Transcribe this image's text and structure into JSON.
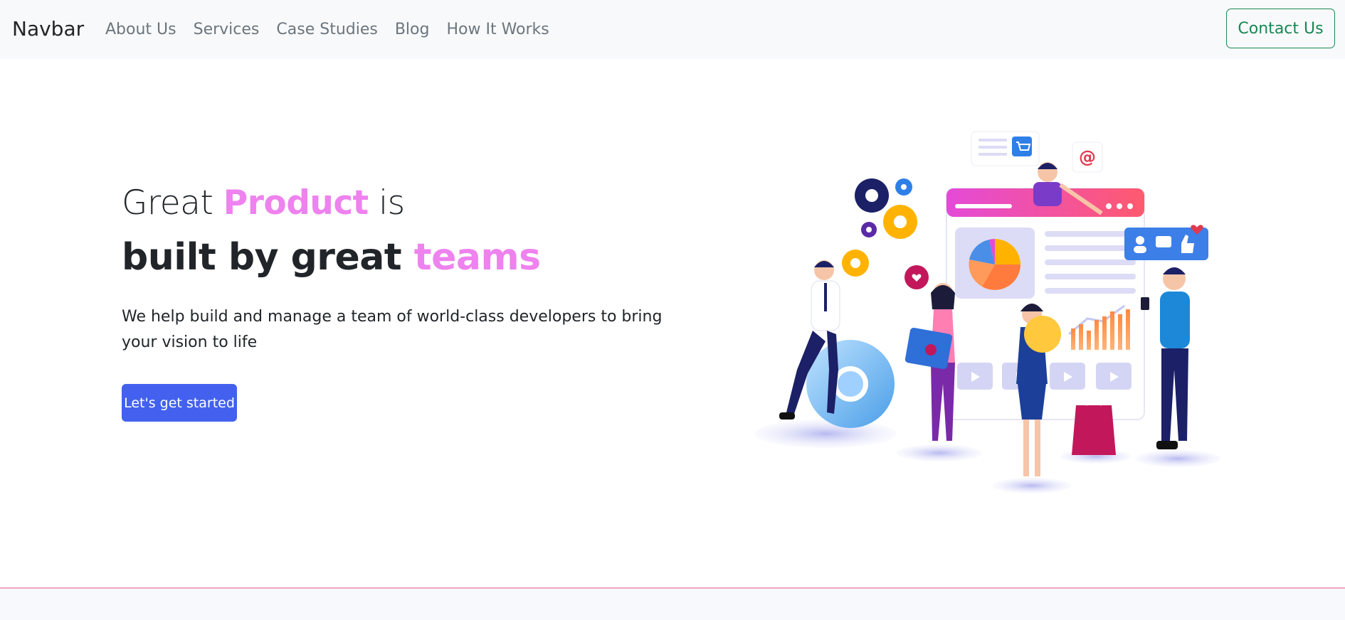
{
  "navbar": {
    "brand": "Navbar",
    "links": [
      "About Us",
      "Services",
      "Case Studies",
      "Blog",
      "How It Works"
    ],
    "contact_label": "Contact Us"
  },
  "hero": {
    "line1_prefix": "Great ",
    "line1_accent": "Product",
    "line1_suffix": " is",
    "line2_prefix": "built by great ",
    "line2_accent": "teams",
    "description": "We help build and manage a team of world-class developers to bring your vision to life",
    "cta_label": "Let's get started"
  },
  "colors": {
    "accent_pink": "#ee82ee",
    "primary_blue": "#4361ee",
    "success_green": "#198754",
    "navbar_bg": "#f8f9fa"
  }
}
